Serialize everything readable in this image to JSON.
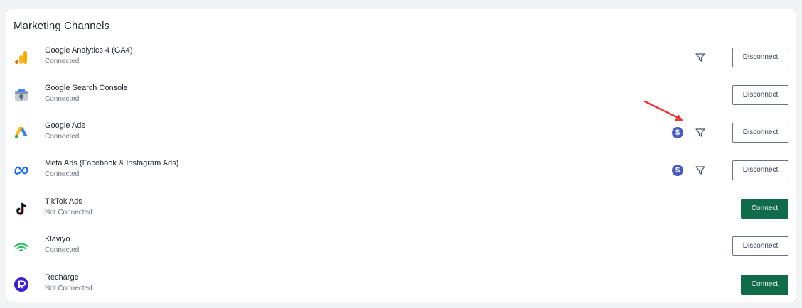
{
  "card": {
    "title": "Marketing Channels"
  },
  "channels": [
    {
      "name": "Google Analytics 4 (GA4)",
      "status": "Connected",
      "action": "Disconnect",
      "icon": "google-analytics-icon"
    },
    {
      "name": "Google Search Console",
      "status": "Connected",
      "action": "Disconnect",
      "icon": "google-search-console-icon"
    },
    {
      "name": "Google Ads",
      "status": "Connected",
      "action": "Disconnect",
      "icon": "google-ads-icon"
    },
    {
      "name": "Meta Ads (Facebook & Instagram Ads)",
      "status": "Connected",
      "action": "Disconnect",
      "icon": "meta-icon"
    },
    {
      "name": "TikTok Ads",
      "status": "Not Connected",
      "action": "Connect",
      "icon": "tiktok-icon"
    },
    {
      "name": "Klaviyo",
      "status": "Connected",
      "action": "Disconnect",
      "icon": "klaviyo-icon"
    },
    {
      "name": "Recharge",
      "status": "Not Connected",
      "action": "Connect",
      "icon": "recharge-icon"
    }
  ],
  "icons": {
    "dollar": "$"
  },
  "colors": {
    "connect_button": "#0f6b4a",
    "dollar_badge": "#4a5bbf",
    "annotation_arrow": "#e53935"
  }
}
